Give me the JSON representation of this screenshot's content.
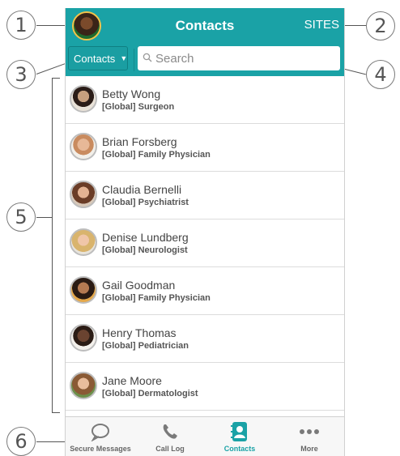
{
  "header": {
    "title": "Contacts",
    "sites_label": "SITES"
  },
  "search": {
    "filter_label": "Contacts",
    "placeholder": "Search"
  },
  "contacts": [
    {
      "name": "Betty Wong",
      "role": "[Global] Surgeon"
    },
    {
      "name": "Brian Forsberg",
      "role": "[Global] Family Physician"
    },
    {
      "name": "Claudia Bernelli",
      "role": "[Global] Psychiatrist"
    },
    {
      "name": "Denise Lundberg",
      "role": "[Global] Neurologist"
    },
    {
      "name": "Gail Goodman",
      "role": "[Global] Family Physician"
    },
    {
      "name": "Henry Thomas",
      "role": "[Global] Pediatrician"
    },
    {
      "name": "Jane Moore",
      "role": "[Global] Dermatologist"
    }
  ],
  "tabs": [
    {
      "label": "Secure Messages",
      "icon": "speech-bubble-icon"
    },
    {
      "label": "Call Log",
      "icon": "phone-icon"
    },
    {
      "label": "Contacts",
      "icon": "contact-book-icon",
      "active": true
    },
    {
      "label": "More",
      "icon": "more-dots-icon"
    }
  ],
  "callouts": [
    "1",
    "2",
    "3",
    "4",
    "5",
    "6"
  ],
  "colors": {
    "accent": "#1aa2a6",
    "avatar_ring": "#bdbdbd",
    "my_avatar_ring": "#f3c34a"
  }
}
